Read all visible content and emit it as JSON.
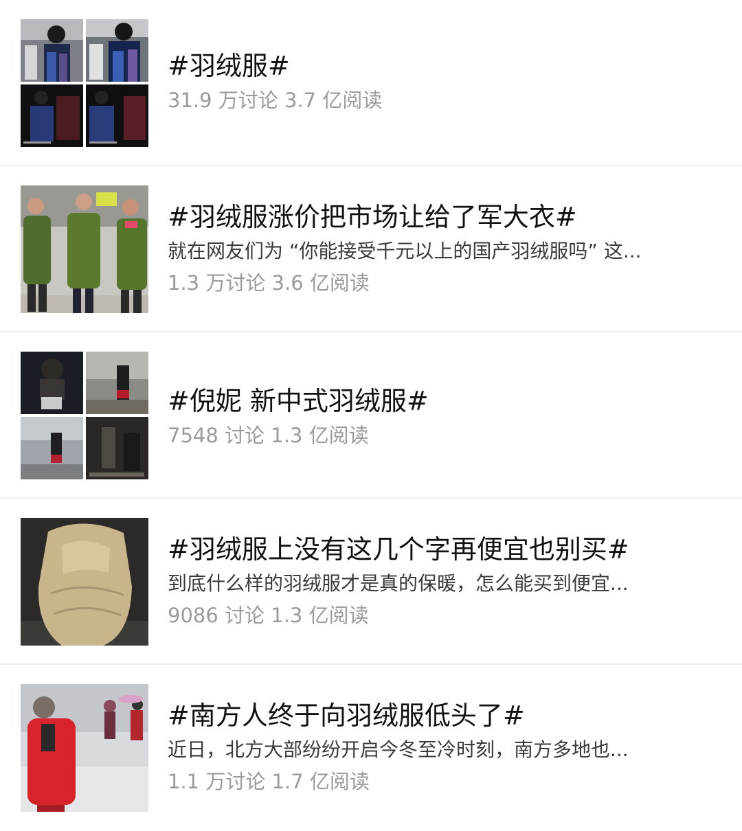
{
  "topics": [
    {
      "title": "#羽绒服#",
      "summary": "",
      "stats": "31.9 万讨论 3.7 亿阅读",
      "thumbnail": "collage-winter-coats"
    },
    {
      "title": "#羽绒服涨价把市场让给了军大衣#",
      "summary": "就在网友们为 “你能接受千元以上的国产羽绒服吗” 这...",
      "stats": "1.3 万讨论 3.6 亿阅读",
      "thumbnail": "people-green-army-coats"
    },
    {
      "title": "#倪妮 新中式羽绒服#",
      "summary": "",
      "stats": "7548 讨论 1.3 亿阅读",
      "thumbnail": "collage-ni-ni-coats"
    },
    {
      "title": "#羽绒服上没有这几个字再便宜也别买#",
      "summary": "到底什么样的羽绒服才是真的保暖，怎么能买到便宜...",
      "stats": "9086 讨论 1.3 亿阅读",
      "thumbnail": "beige-down-jacket"
    },
    {
      "title": "#南方人终于向羽绒服低头了#",
      "summary": "近日，北方大部纷纷开启今冬至冷时刻，南方多地也...",
      "stats": "1.1 万讨论 1.7 亿阅读",
      "thumbnail": "red-coat-in-snow"
    }
  ]
}
